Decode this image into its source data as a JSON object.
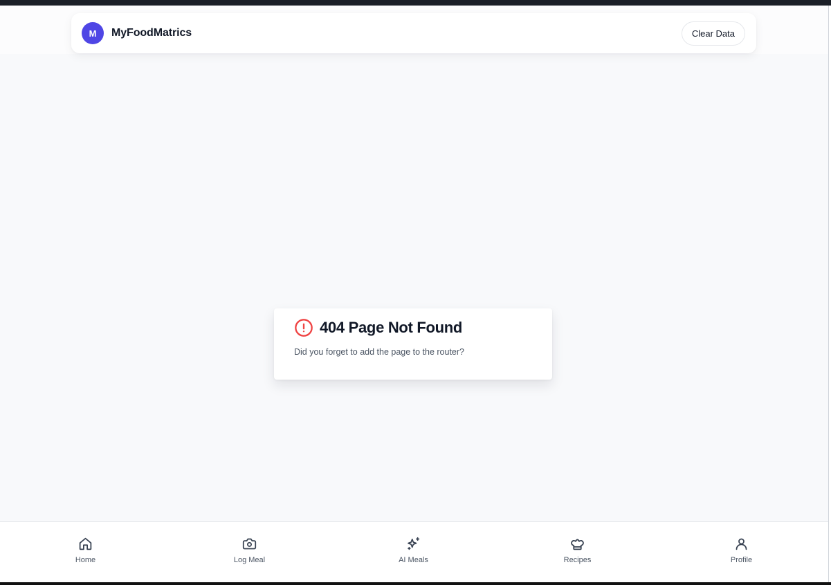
{
  "header": {
    "logo_letter": "M",
    "app_name": "MyFoodMatrics",
    "clear_button_label": "Clear Data",
    "brand_color": "#4f46e5"
  },
  "error_card": {
    "icon": "alert-circle-icon",
    "icon_color": "#ef4444",
    "title": "404 Page Not Found",
    "message": "Did you forget to add the page to the router?"
  },
  "bottom_nav": {
    "items": [
      {
        "label": "Home",
        "icon": "home-icon"
      },
      {
        "label": "Log Meal",
        "icon": "camera-icon"
      },
      {
        "label": "AI Meals",
        "icon": "sparkles-icon"
      },
      {
        "label": "Recipes",
        "icon": "chef-hat-icon"
      },
      {
        "label": "Profile",
        "icon": "user-icon"
      }
    ]
  }
}
